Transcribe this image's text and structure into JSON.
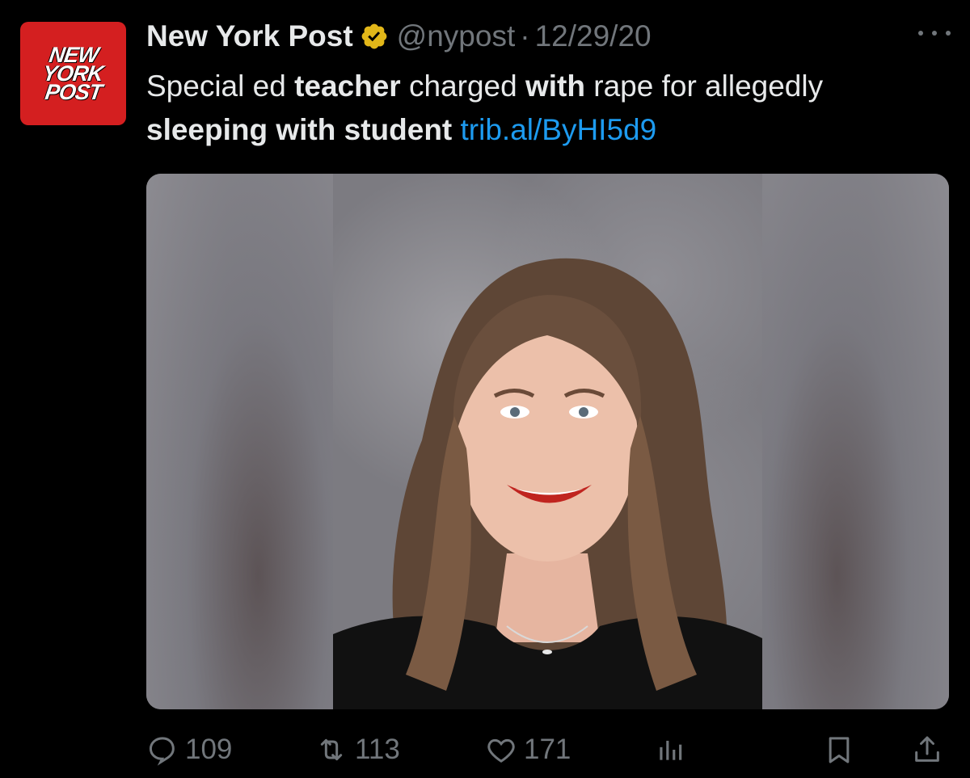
{
  "tweet": {
    "avatar_logo_lines": [
      "NEW",
      "YORK",
      "POST"
    ],
    "display_name": "New York Post",
    "verified": true,
    "handle": "@nypost",
    "separator": "·",
    "timestamp": "12/29/20",
    "text_segments": [
      {
        "text": "Special ed ",
        "style": "normal"
      },
      {
        "text": "teacher",
        "style": "bold"
      },
      {
        "text": " charged ",
        "style": "normal"
      },
      {
        "text": "with",
        "style": "bold"
      },
      {
        "text": " rape for allegedly ",
        "style": "normal"
      },
      {
        "text": "sleeping with student",
        "style": "bold"
      },
      {
        "text": " ",
        "style": "normal"
      },
      {
        "text": "trib.al/ByHI5d9",
        "style": "link"
      }
    ]
  },
  "actions": {
    "reply_count": "109",
    "retweet_count": "113",
    "like_count": "171"
  },
  "icons": {
    "avatar": "new-york-post-logo",
    "verified": "gold-verified-badge-icon",
    "more": "more-horizontal-icon",
    "reply": "reply-icon",
    "retweet": "retweet-icon",
    "like": "heart-icon",
    "views": "views-chart-icon",
    "bookmark": "bookmark-icon",
    "share": "share-icon"
  },
  "colors": {
    "background": "#000000",
    "text": "#e7e9ea",
    "secondary": "#71767b",
    "link": "#1d9bf0",
    "avatar_red": "#d41f20",
    "verified_gold": "#e2b719"
  }
}
